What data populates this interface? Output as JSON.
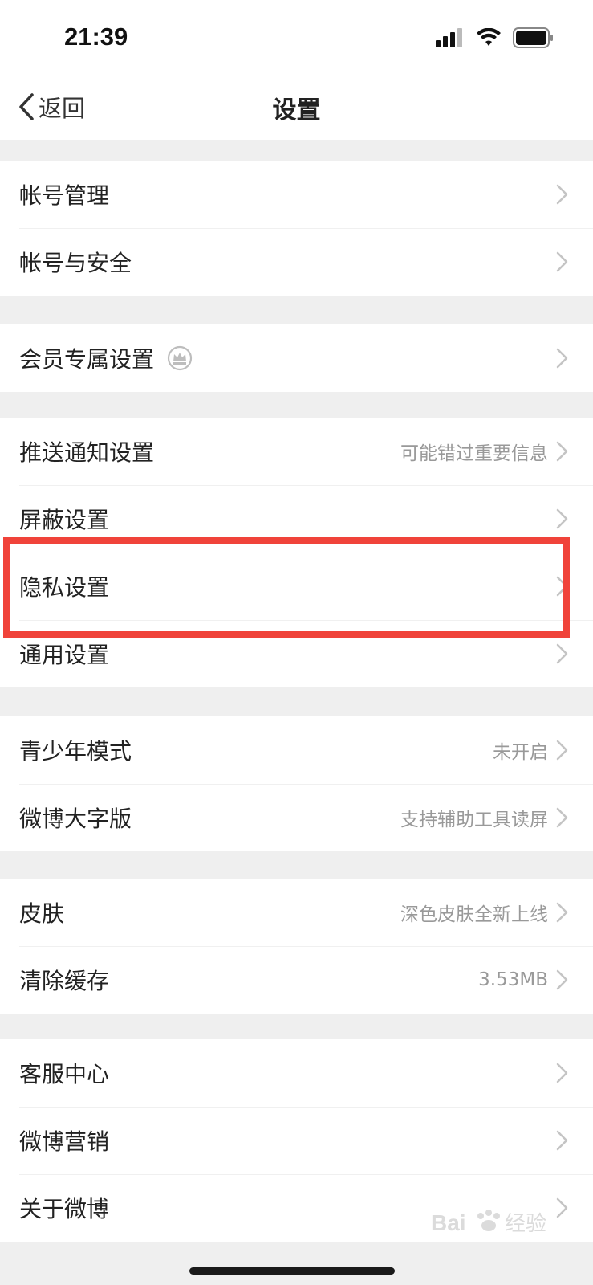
{
  "status_bar": {
    "time": "21:39",
    "icons": [
      "signal-icon",
      "wifi-icon",
      "battery-icon"
    ]
  },
  "nav": {
    "back_label": "返回",
    "title": "设置"
  },
  "groups": [
    {
      "items": [
        {
          "label": "帐号管理",
          "value": ""
        },
        {
          "label": "帐号与安全",
          "value": ""
        }
      ]
    },
    {
      "items": [
        {
          "label": "会员专属设置",
          "value": "",
          "icon": "crown-icon"
        }
      ]
    },
    {
      "items": [
        {
          "label": "推送通知设置",
          "value": "可能错过重要信息"
        },
        {
          "label": "屏蔽设置",
          "value": ""
        },
        {
          "label": "隐私设置",
          "value": "",
          "highlighted": true
        },
        {
          "label": "通用设置",
          "value": ""
        }
      ]
    },
    {
      "items": [
        {
          "label": "青少年模式",
          "value": "未开启"
        },
        {
          "label": "微博大字版",
          "value": "支持辅助工具读屏"
        }
      ]
    },
    {
      "items": [
        {
          "label": "皮肤",
          "value": "深色皮肤全新上线"
        },
        {
          "label": "清除缓存",
          "value": "3.53MB"
        }
      ]
    },
    {
      "items": [
        {
          "label": "客服中心",
          "value": ""
        },
        {
          "label": "微博营销",
          "value": ""
        },
        {
          "label": "关于微博",
          "value": ""
        }
      ]
    }
  ],
  "colors": {
    "highlight": "#f0433a",
    "separator": "#efefef",
    "value_text": "#999999"
  },
  "watermark": "Bai du 经验"
}
